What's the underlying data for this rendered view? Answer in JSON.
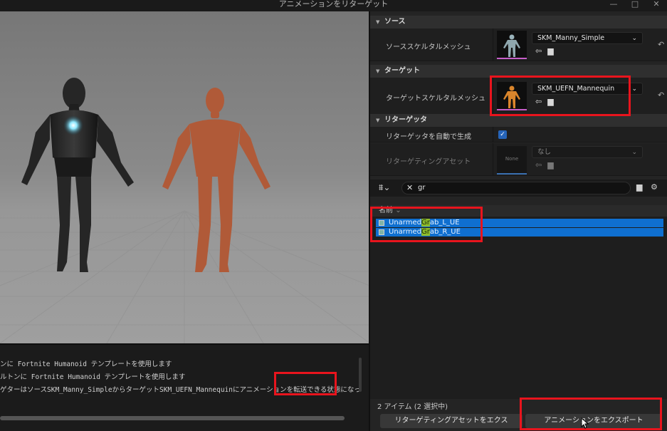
{
  "window": {
    "title": "アニメーションをリターゲット",
    "minimize_glyph": "—",
    "maximize_glyph": "□",
    "close_glyph": "✕"
  },
  "log": {
    "lines": [
      "ンに Fortnite Humanoid テンプレートを使用します",
      "ルトンに Fortnite Humanoid テンプレートを使用します",
      "ゲターはソースSKM_Manny_SimpleからターゲットSKM_UEFN_Mannequinにアニメーションを転送できる状態になってい"
    ]
  },
  "panel": {
    "source": {
      "header": "ソース",
      "label": "ソーススケルタルメッシュ",
      "value": "SKM_Manny_Simple"
    },
    "target": {
      "header": "ターゲット",
      "label": "ターゲットスケルタルメッシュ",
      "value": "SKM_UEFN_Mannequin"
    },
    "retargeter": {
      "header": "リターゲッタ",
      "auto_label": "リターゲッタを自動で生成",
      "auto_checked": true,
      "asset_label": "リターゲティングアセット",
      "asset_value": "なし",
      "asset_thumb": "None"
    },
    "search": {
      "query": "gr"
    },
    "list": {
      "header": "名前",
      "items": [
        {
          "pre": "Unarmed",
          "hl": "Gr",
          "post": "ab_L_UE"
        },
        {
          "pre": "Unarmed",
          "hl": "Gr",
          "post": "ab_R_UE"
        }
      ]
    },
    "count_text": "2 アイテム (2 選択中)",
    "export_retarget_label": "リターゲティングアセットをエクス",
    "export_anim_label": "アニメーションをエクスポート"
  },
  "icons": {
    "reset": "reset-arrow-icon",
    "browse": "browse-icon",
    "folder": "folder-icon",
    "filter": "filter-icon",
    "settings": "gear-icon"
  },
  "colors": {
    "highlight_box": "#e8141d",
    "selection": "#0f6fd0",
    "match_highlight": "#8fbc2a",
    "manny_orange": "#b05a38"
  }
}
